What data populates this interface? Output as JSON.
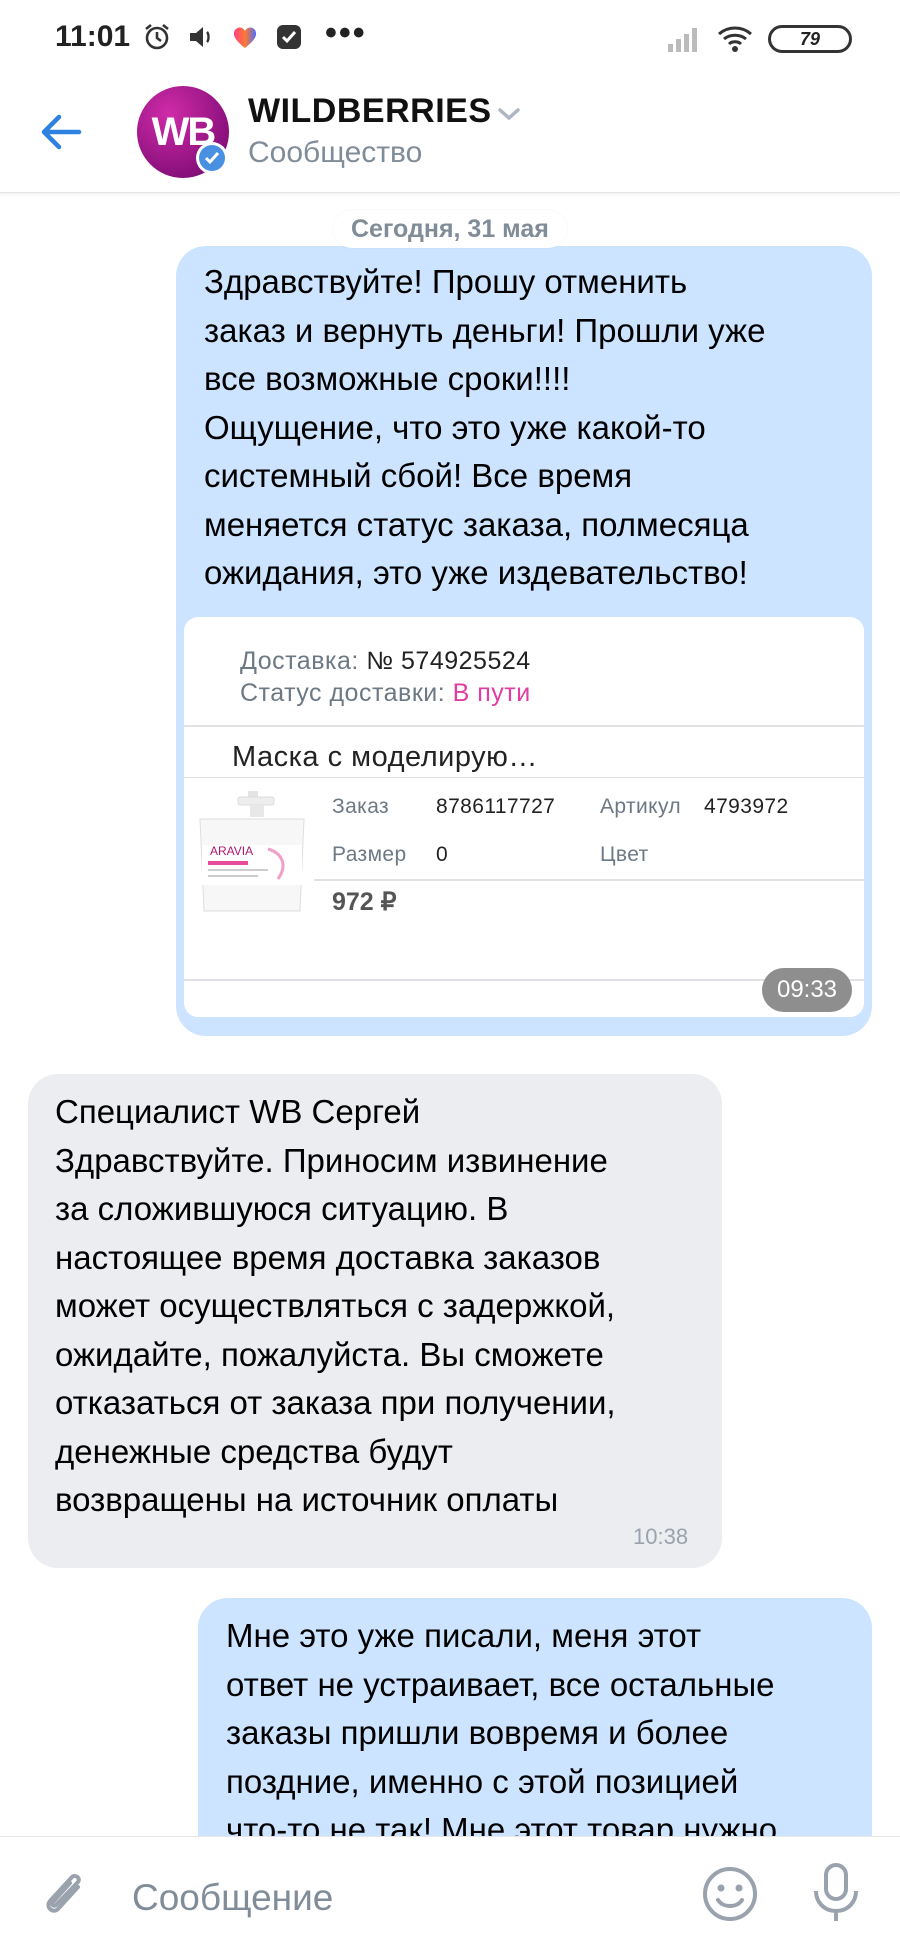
{
  "status_bar": {
    "time": "11:01",
    "battery": "79",
    "more": "•••",
    "icons": [
      "alarm-icon",
      "volume-icon",
      "heart-icon",
      "notification-icon",
      "signal-icon",
      "wifi-icon",
      "battery-icon"
    ]
  },
  "header": {
    "title": "WILDBERRIES",
    "subtitle": "Сообщество",
    "avatar_text": "WB",
    "brand_color": "#a41a96",
    "accent_color": "#2d81e0"
  },
  "chat": {
    "date_separator": "Сегодня, 31 мая",
    "messages": [
      {
        "text": "Здравствуйте! Прошу отменить\nзаказ и вернуть деньги! Прошли уже\nвсе возможные сроки!!!!\nОщущение, что это уже какой-то\nсистемный сбой! Все время\nменяется статус заказа, полмесяца\nожидания, это уже издевательство!",
        "time": "09:33",
        "attachment": {
          "delivery_label": "Доставка:",
          "delivery_value": "№ 574925524",
          "status_label": "Статус доставки:",
          "status_value": "В пути",
          "product_name": "Маска с моделирую…",
          "product_image_text": "ARAVIA",
          "order_label": "Заказ",
          "order_value": "8786117727",
          "article_label": "Артикул",
          "article_value": "4793972",
          "size_label": "Размер",
          "size_value": "0",
          "color_label": "Цвет",
          "price": "972 ₽"
        }
      },
      {
        "text": "Специалист WB Сергей\nЗдравствуйте. Приносим извинение\nза сложившуюся ситуацию. В\nнастоящее время доставка заказов\nможет осуществляться с задержкой,\nожидайте, пожалуйста. Вы сможете\nотказаться от заказа при получении,\nденежные средства будут\nвозвращены на источник оплаты",
        "time": "10:38"
      },
      {
        "text": "Мне это уже писали, меня этот\nответ не устраивает, все остальные\nзаказы пришли вовремя и более\nпоздние, именно с этой позицией\nчто-то не так! Мне этот товар нужно"
      }
    ]
  },
  "composer": {
    "placeholder": "Сообщение"
  }
}
